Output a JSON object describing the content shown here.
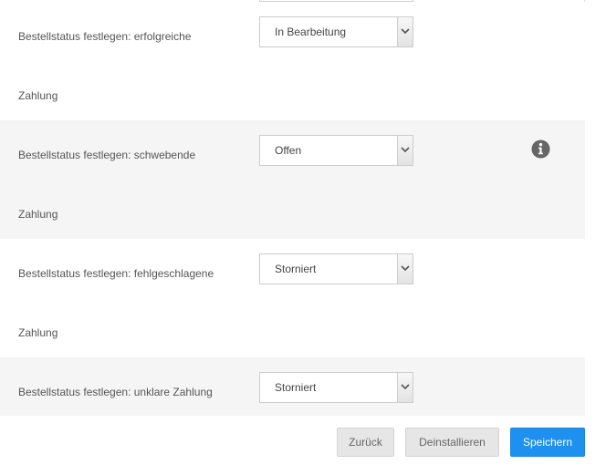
{
  "rows": [
    {
      "label_line1": "Bestellstatus festlegen: erfolgreiche",
      "label_line2": "Zahlung",
      "select_value": "In Bearbeitung",
      "shaded": false
    },
    {
      "label_line1": "Bestellstatus festlegen: schwebende",
      "label_line2": "Zahlung",
      "select_value": "Offen",
      "shaded": true,
      "icon": "info-icon"
    },
    {
      "label_line1": "Bestellstatus festlegen: fehlgeschlagene",
      "label_line2": "Zahlung",
      "select_value": "Storniert",
      "shaded": false
    },
    {
      "label_line1": "Bestellstatus festlegen: unklare Zahlung",
      "label_line2": "",
      "select_value": "Storniert",
      "shaded": true
    }
  ],
  "buttons": {
    "back_label": "Zurück",
    "uninstall_label": "Deinstallieren",
    "save_label": "Speichern"
  },
  "colors": {
    "primary_button": "#1e90f0",
    "row_shade": "#f5f5f5",
    "info_icon": "#666666"
  }
}
